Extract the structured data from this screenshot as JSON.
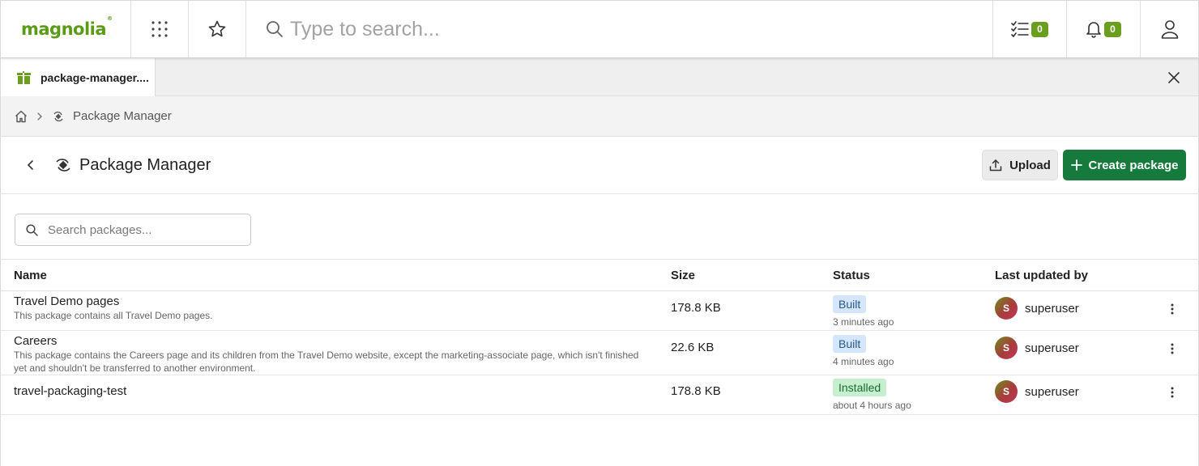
{
  "brand": {
    "logo_text": "magnolia",
    "logo_mark": "®",
    "accent": "#6b9e1f",
    "primary": "#177a3d"
  },
  "topbar": {
    "apps_icon": "grid-icon",
    "favorites_icon": "star-icon",
    "search_placeholder": "Type to search...",
    "tasks_count": "0",
    "notifications_count": "0",
    "user_icon": "user-icon"
  },
  "tabs": [
    {
      "label": "package-manager....",
      "icon": "package-icon"
    }
  ],
  "breadcrumb": {
    "home_icon": "home-icon",
    "current": "Package Manager"
  },
  "header": {
    "title": "Package Manager",
    "upload_label": "Upload",
    "create_label": "Create package"
  },
  "filter": {
    "placeholder": "Search packages..."
  },
  "table": {
    "columns": [
      "Name",
      "Size",
      "Status",
      "Last updated by"
    ],
    "rows": [
      {
        "name": "Travel Demo pages",
        "description": "This package contains all Travel Demo pages.",
        "size": "178.8 KB",
        "status": "Built",
        "status_time": "3 minutes ago",
        "avatar": "S",
        "user": "superuser"
      },
      {
        "name": "Careers",
        "description": "This package contains the Careers page and its children from the Travel Demo website, except the marketing-associate page, which isn't finished yet and shouldn't be transferred to another environment.",
        "size": "22.6 KB",
        "status": "Built",
        "status_time": "4 minutes ago",
        "avatar": "S",
        "user": "superuser"
      },
      {
        "name": "travel-packaging-test",
        "description": "",
        "size": "178.8 KB",
        "status": "Installed",
        "status_time": "about 4 hours ago",
        "avatar": "S",
        "user": "superuser"
      }
    ]
  }
}
